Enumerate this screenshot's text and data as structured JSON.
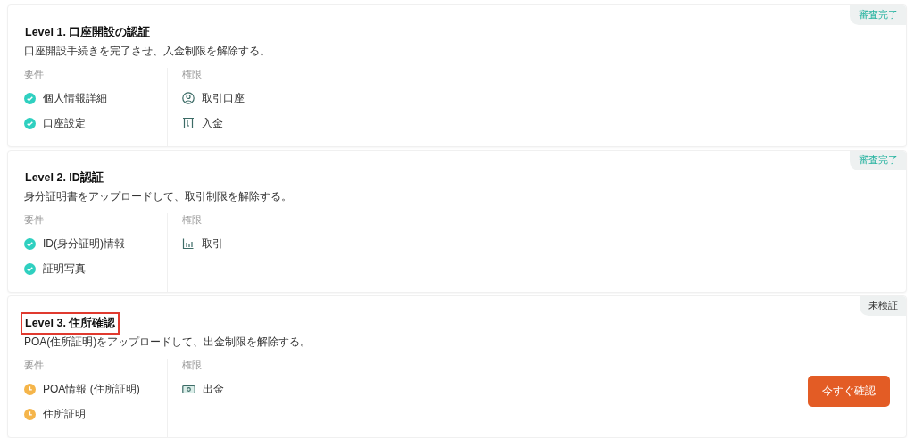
{
  "levels": [
    {
      "title": "Level 1. 口座開設の認証",
      "highlighted": false,
      "description": "口座開設手続きを完了させ、入金制限を解除する。",
      "badge": {
        "label": "審査完了",
        "kind": "approved"
      },
      "requirements_label": "要件",
      "permissions_label": "権限",
      "requirements": [
        {
          "label": "個人情報詳細",
          "kind": "done"
        },
        {
          "label": "口座設定",
          "kind": "done"
        }
      ],
      "permissions": [
        {
          "label": "取引口座",
          "kind": "account"
        },
        {
          "label": "入金",
          "kind": "deposit"
        }
      ]
    },
    {
      "title": "Level 2. ID認証",
      "highlighted": false,
      "description": "身分証明書をアップロードして、取引制限を解除する。",
      "badge": {
        "label": "審査完了",
        "kind": "approved"
      },
      "requirements_label": "要件",
      "permissions_label": "権限",
      "requirements": [
        {
          "label": "ID(身分証明)情報",
          "kind": "done"
        },
        {
          "label": "証明写真",
          "kind": "done"
        }
      ],
      "permissions": [
        {
          "label": "取引",
          "kind": "trade"
        }
      ]
    },
    {
      "title": "Level 3. 住所確認",
      "highlighted": true,
      "description": "POA(住所証明)をアップロードして、出金制限を解除する。",
      "badge": {
        "label": "未検証",
        "kind": "unverified"
      },
      "requirements_label": "要件",
      "permissions_label": "権限",
      "requirements": [
        {
          "label": "POA情報 (住所証明)",
          "kind": "pending"
        },
        {
          "label": "住所証明",
          "kind": "pending"
        }
      ],
      "permissions": [
        {
          "label": "出金",
          "kind": "withdraw"
        }
      ],
      "action": "今すぐ確認"
    }
  ]
}
